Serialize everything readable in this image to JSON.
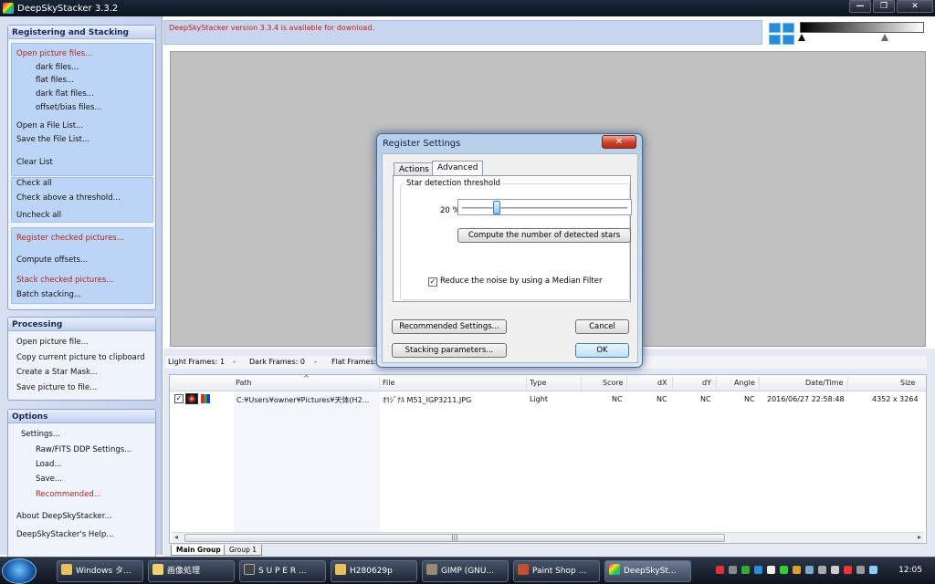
{
  "window": {
    "title": "DeepSkyStacker 3.3.2",
    "buttons": {
      "minimize": "—",
      "maximize": "❐",
      "close": "✕"
    }
  },
  "notification": "DeepSkyStacker version 3.3.4 is available for download.",
  "sidebar": {
    "registering": {
      "heading": "Registering and Stacking",
      "open": "Open picture files...",
      "dark": "dark files...",
      "flat": "flat files...",
      "darkflat": "dark flat files...",
      "offset": "offset/bias files...",
      "open_list": "Open a File List...",
      "save_list": "Save the File List...",
      "clear": "Clear List",
      "check_all": "Check all",
      "check_above": "Check above a threshold...",
      "uncheck_all": "Uncheck all",
      "register": "Register checked pictures...",
      "compute": "Compute offsets...",
      "stack": "Stack checked pictures...",
      "batch": "Batch stacking..."
    },
    "processing": {
      "heading": "Processing",
      "open": "Open picture file...",
      "copy": "Copy current picture to clipboard",
      "mask": "Create a Star Mask...",
      "save": "Save picture to file..."
    },
    "options": {
      "heading": "Options",
      "settings": "Settings...",
      "raw": "Raw/FITS DDP Settings...",
      "load": "Load...",
      "save": "Save...",
      "recommended": "Recommended...",
      "about": "About DeepSkyStacker...",
      "help": "DeepSkyStacker's Help..."
    }
  },
  "frames": {
    "light": "Light Frames: 1",
    "dark": "Dark Frames: 0",
    "flat": "Flat Frames:",
    "sep": "-"
  },
  "list": {
    "headers": {
      "path": "Path",
      "file": "File",
      "type": "Type",
      "score": "Score",
      "dx": "dX",
      "dy": "dY",
      "angle": "Angle",
      "datetime": "Date/Time",
      "size": "Size",
      "sort": "^"
    },
    "row": {
      "path": "C:¥Users¥owner¥Pictures¥天体(H2...",
      "file": "ｵﾘｼﾞﾅﾙ M51_IGP3211.JPG",
      "type": "Light",
      "score": "NC",
      "dx": "NC",
      "dy": "NC",
      "angle": "NC",
      "datetime": "2016/06/27 22:58:48",
      "size": "4352 x 3264",
      "check": "✓"
    },
    "scroll_grip": "|||",
    "tabs": [
      "Main Group",
      "Group 1"
    ]
  },
  "dialog": {
    "title": "Register Settings",
    "close": "✕",
    "tabs": [
      "Actions",
      "Advanced"
    ],
    "group_label": "Star detection threshold",
    "threshold": "20 %",
    "threshold_value": 20,
    "compute_button": "Compute the number of detected stars",
    "median_label": "Reduce the noise by using a Median Filter",
    "median_checked": "✓",
    "recommended": "Recommended Settings...",
    "stacking": "Stacking parameters...",
    "cancel": "Cancel",
    "ok": "OK"
  },
  "taskbar": {
    "items": [
      "Windows タ...",
      "画像処理",
      "S U P E R ...",
      "H280629p",
      "GIMP (GNU...",
      "Paint Shop ...",
      "DeepSkySt..."
    ],
    "clock": "12:05"
  }
}
